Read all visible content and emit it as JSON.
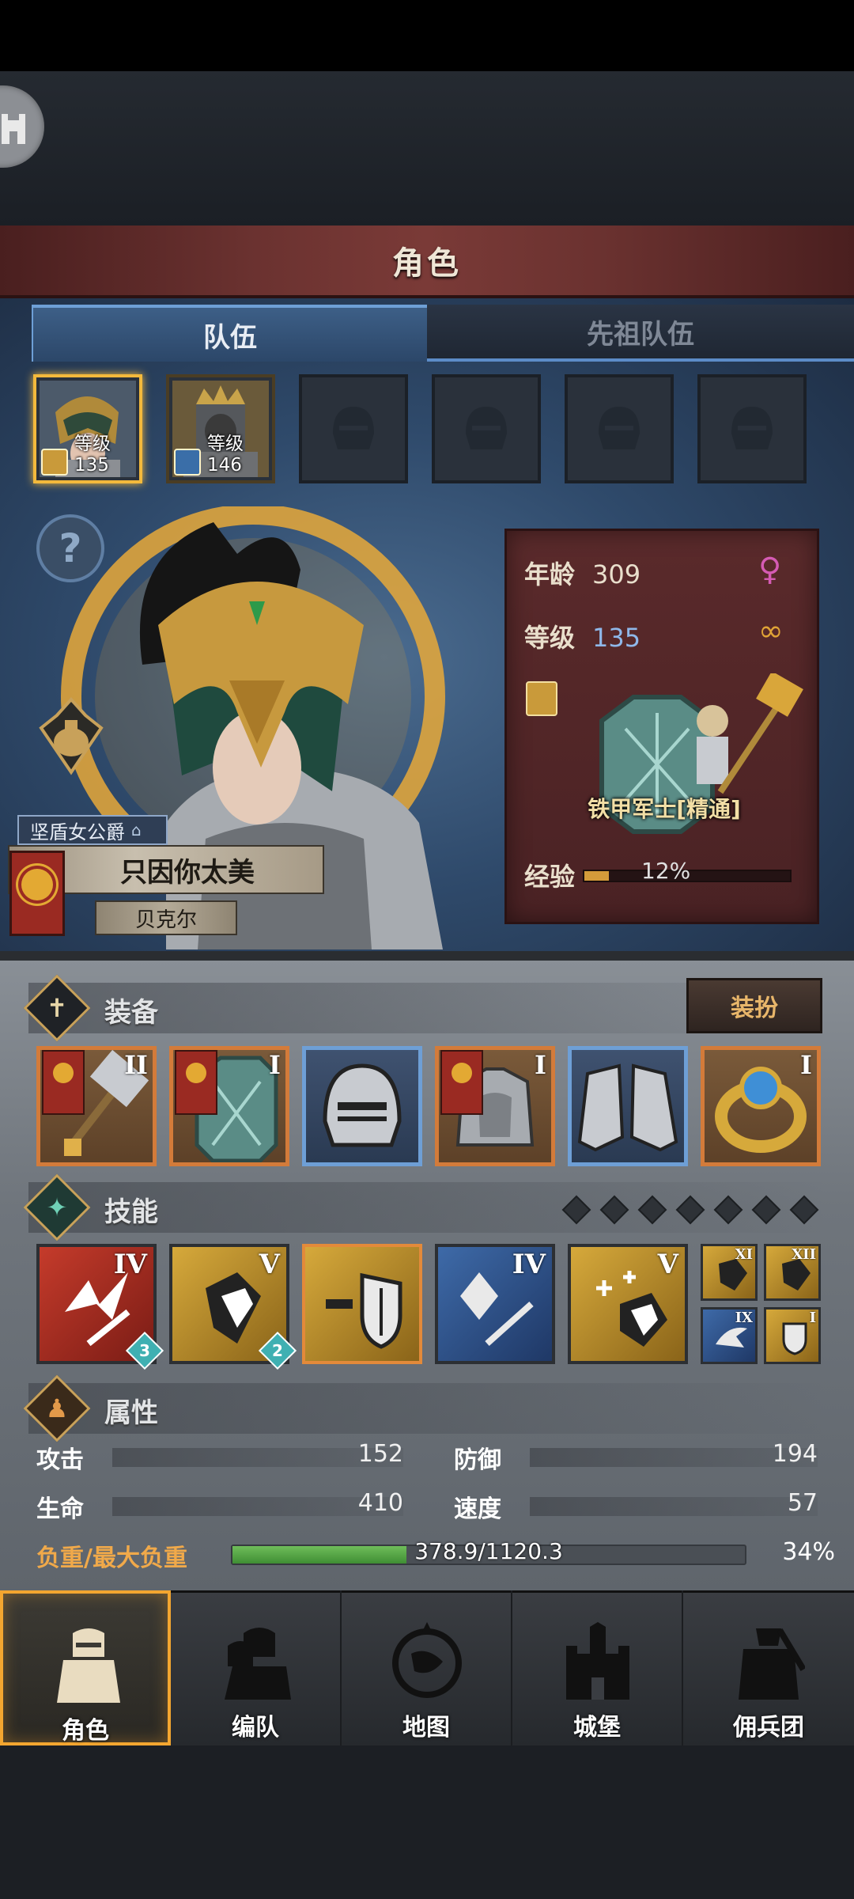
{
  "header": {
    "title": "角色"
  },
  "tabs": [
    {
      "label": "队伍",
      "active": true
    },
    {
      "label": "先祖队伍",
      "active": false
    }
  ],
  "party": {
    "slots": [
      {
        "level_label": "等级135",
        "selected": true,
        "class_icon": "shield-class-icon"
      },
      {
        "level_label": "等级146",
        "selected": false,
        "class_icon": "sword-class-icon"
      },
      {
        "empty": true
      },
      {
        "empty": true
      },
      {
        "empty": true
      },
      {
        "empty": true
      }
    ]
  },
  "hero": {
    "title": "坚盾女公爵",
    "name": "只因你太美",
    "surname": "贝克尔"
  },
  "stats_card": {
    "age_label": "年龄",
    "age": "309",
    "level_label": "等级",
    "level": "135",
    "gender_icon": "female-symbol-icon",
    "class_name": "铁甲军士[精通]",
    "exp_label": "经验",
    "exp_percent_text": "12%",
    "exp_progress": 0.12
  },
  "equipment": {
    "label": "装备",
    "dress_button": "装扮",
    "items": [
      {
        "name": "warhammer",
        "tier": "II",
        "rarity": "orange",
        "banner": true
      },
      {
        "name": "tower-shield",
        "tier": "I",
        "rarity": "orange",
        "banner": true
      },
      {
        "name": "knight-helmet",
        "tier": "",
        "rarity": "blue",
        "banner": false
      },
      {
        "name": "plate-armor",
        "tier": "I",
        "rarity": "orange",
        "banner": true
      },
      {
        "name": "plate-boots",
        "tier": "",
        "rarity": "blue",
        "banner": false
      },
      {
        "name": "sapphire-ring",
        "tier": "I",
        "rarity": "orange",
        "banner": false
      }
    ]
  },
  "skills": {
    "label": "技能",
    "slot_pips": 7,
    "items": [
      {
        "tier": "IV",
        "color": "red",
        "count": "3"
      },
      {
        "tier": "V",
        "color": "gold",
        "count": "2"
      },
      {
        "tier": "",
        "color": "gold",
        "count": "",
        "selected": true
      },
      {
        "tier": "IV",
        "color": "blue",
        "count": ""
      },
      {
        "tier": "V",
        "color": "gold",
        "count": ""
      }
    ],
    "mini": [
      {
        "tier": "XI",
        "color": "gold"
      },
      {
        "tier": "XII",
        "color": "gold"
      },
      {
        "tier": "IX",
        "color": "blue"
      },
      {
        "tier": "I",
        "color": "gold"
      }
    ]
  },
  "attributes": {
    "label": "属性",
    "attack_label": "攻击",
    "attack": "152",
    "defense_label": "防御",
    "defense": "194",
    "hp_label": "生命",
    "hp": "410",
    "speed_label": "速度",
    "speed": "57",
    "load_label": "负重/最大负重",
    "load_text": "378.9/1120.3",
    "load_percent_text": "34%",
    "load_progress": 0.34
  },
  "nav": [
    {
      "label": "角色",
      "icon": "knight-icon",
      "active": true
    },
    {
      "label": "编队",
      "icon": "formation-icon",
      "active": false
    },
    {
      "label": "地图",
      "icon": "compass-map-icon",
      "active": false
    },
    {
      "label": "城堡",
      "icon": "castle-icon",
      "active": false
    },
    {
      "label": "佣兵团",
      "icon": "mercenary-icon",
      "active": false
    }
  ],
  "colors": {
    "accent_gold": "#f3b93c",
    "rare_orange": "#d37b3a",
    "rare_blue": "#6e9fd6",
    "female": "#d55bb4",
    "load_green": "#5fae4c"
  }
}
